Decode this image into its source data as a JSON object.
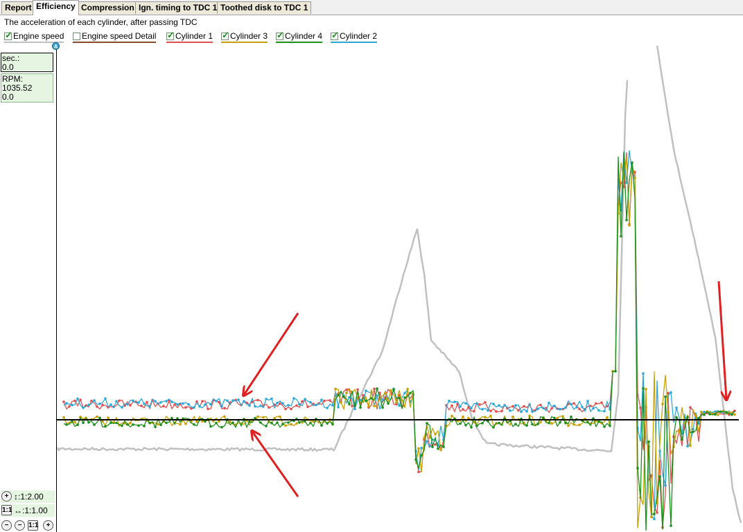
{
  "tabs": [
    {
      "label": "Report",
      "active": false
    },
    {
      "label": "Efficiency",
      "active": true
    },
    {
      "label": "Compression",
      "active": false
    },
    {
      "label": "Ign. timing to TDC 1",
      "active": false
    },
    {
      "label": "Toothed disk to TDC 1",
      "active": false
    }
  ],
  "subtitle": "The acceleration of each cylinder, after passing TDC",
  "legend": [
    {
      "label": "Engine speed",
      "checked": true,
      "color": "#c0c0c0"
    },
    {
      "label": "Engine speed Detail",
      "checked": false,
      "color": "#8a4a2a"
    },
    {
      "label": "Cylinder 1",
      "checked": true,
      "color": "#e05050"
    },
    {
      "label": "Cylinder 3",
      "checked": true,
      "color": "#c8a000"
    },
    {
      "label": "Cylinder 4",
      "checked": true,
      "color": "#1a8f1a"
    },
    {
      "label": "Cylinder 2",
      "checked": true,
      "color": "#2aa8d8"
    }
  ],
  "readout": {
    "sec_label": "sec.:",
    "sec_value": "0.0",
    "rpm_label": "RPM:",
    "rpm_value": "1035.52",
    "rpm_value2": "0.0"
  },
  "marker_label": "A",
  "zoom": {
    "vertical": "↕:1:2.00",
    "horizontal": "↔:1:1.00",
    "one_to_one": "1:1"
  },
  "colors": {
    "annotation_arrow": "#e02020",
    "zero_line": "#000000",
    "panel_green": "#e6f5e2"
  },
  "chart_data": {
    "type": "line",
    "series": [
      {
        "name": "Engine speed"
      },
      {
        "name": "Cylinder 1"
      },
      {
        "name": "Cylinder 3"
      },
      {
        "name": "Cylinder 4"
      },
      {
        "name": "Cylinder 2"
      }
    ],
    "grid": false,
    "legend_position": "top"
  }
}
